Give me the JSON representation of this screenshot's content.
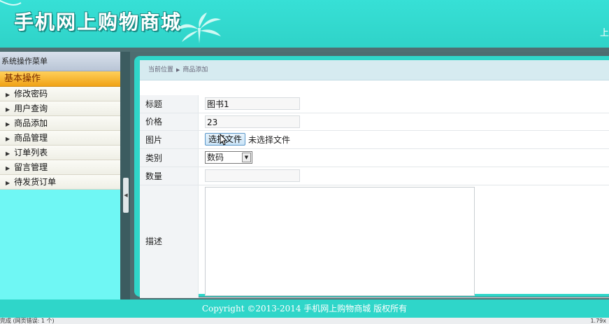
{
  "header": {
    "title": "手机网上购物商城",
    "right_text": "上"
  },
  "sidebar": {
    "title": "系统操作菜单",
    "group": "基本操作",
    "items": [
      {
        "label": "修改密码"
      },
      {
        "label": "用户查询"
      },
      {
        "label": "商品添加"
      },
      {
        "label": "商品管理"
      },
      {
        "label": "订单列表"
      },
      {
        "label": "留言管理"
      },
      {
        "label": "待发货订单"
      }
    ]
  },
  "breadcrumb": {
    "prefix": "当前位置",
    "current": "商品添加"
  },
  "form": {
    "title_label": "标题",
    "title_value": "图书1",
    "price_label": "价格",
    "price_value": "23",
    "image_label": "图片",
    "file_button": "选择文件",
    "file_status": "未选择文件",
    "category_label": "类别",
    "category_value": "数码",
    "quantity_label": "数量",
    "quantity_value": "",
    "description_label": "描述"
  },
  "footer": {
    "copyright": "Copyright ©2013-2014 手机网上购物商城 版权所有"
  },
  "statusbar": {
    "left": "完成 (网页错误: 1 个)",
    "zoom": "1.79x"
  },
  "colors": {
    "accent": "#2fd6c9",
    "sidebar_bg": "#6ff7f4",
    "group_bg": "#f0a316"
  }
}
